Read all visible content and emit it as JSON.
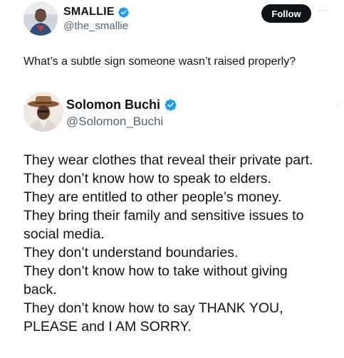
{
  "outer_tweet": {
    "author_name": "SMALLIE",
    "author_handle": "@the_smallie",
    "follow_label": "Follow",
    "more_label": "···",
    "text": "What’s a subtle sign someone wasn’t raised properly?"
  },
  "quoted_tweet": {
    "author_name": "Solomon Buchi",
    "author_handle": "@Solomon_Buchi",
    "more_label": "··",
    "lines": [
      "They wear clothes that reveal their private part.",
      "They don’t know how to speak to elders.",
      "They are entitled to other people’s money.",
      "They bring their family and sensitive issues to",
      "social media.",
      "They don’t understand boundaries.",
      "They don’t know how to take without giving",
      "back.",
      "They don’t know how to say THANK YOU,",
      "PLEASE and I AM SORRY."
    ]
  },
  "colors": {
    "verified_blue": "#1d9bf0",
    "text_primary": "#0f1419",
    "text_secondary": "#536471",
    "follow_bg": "#0f1419"
  },
  "icons": {
    "verified": "verified-badge-icon",
    "more": "more-options-icon"
  }
}
